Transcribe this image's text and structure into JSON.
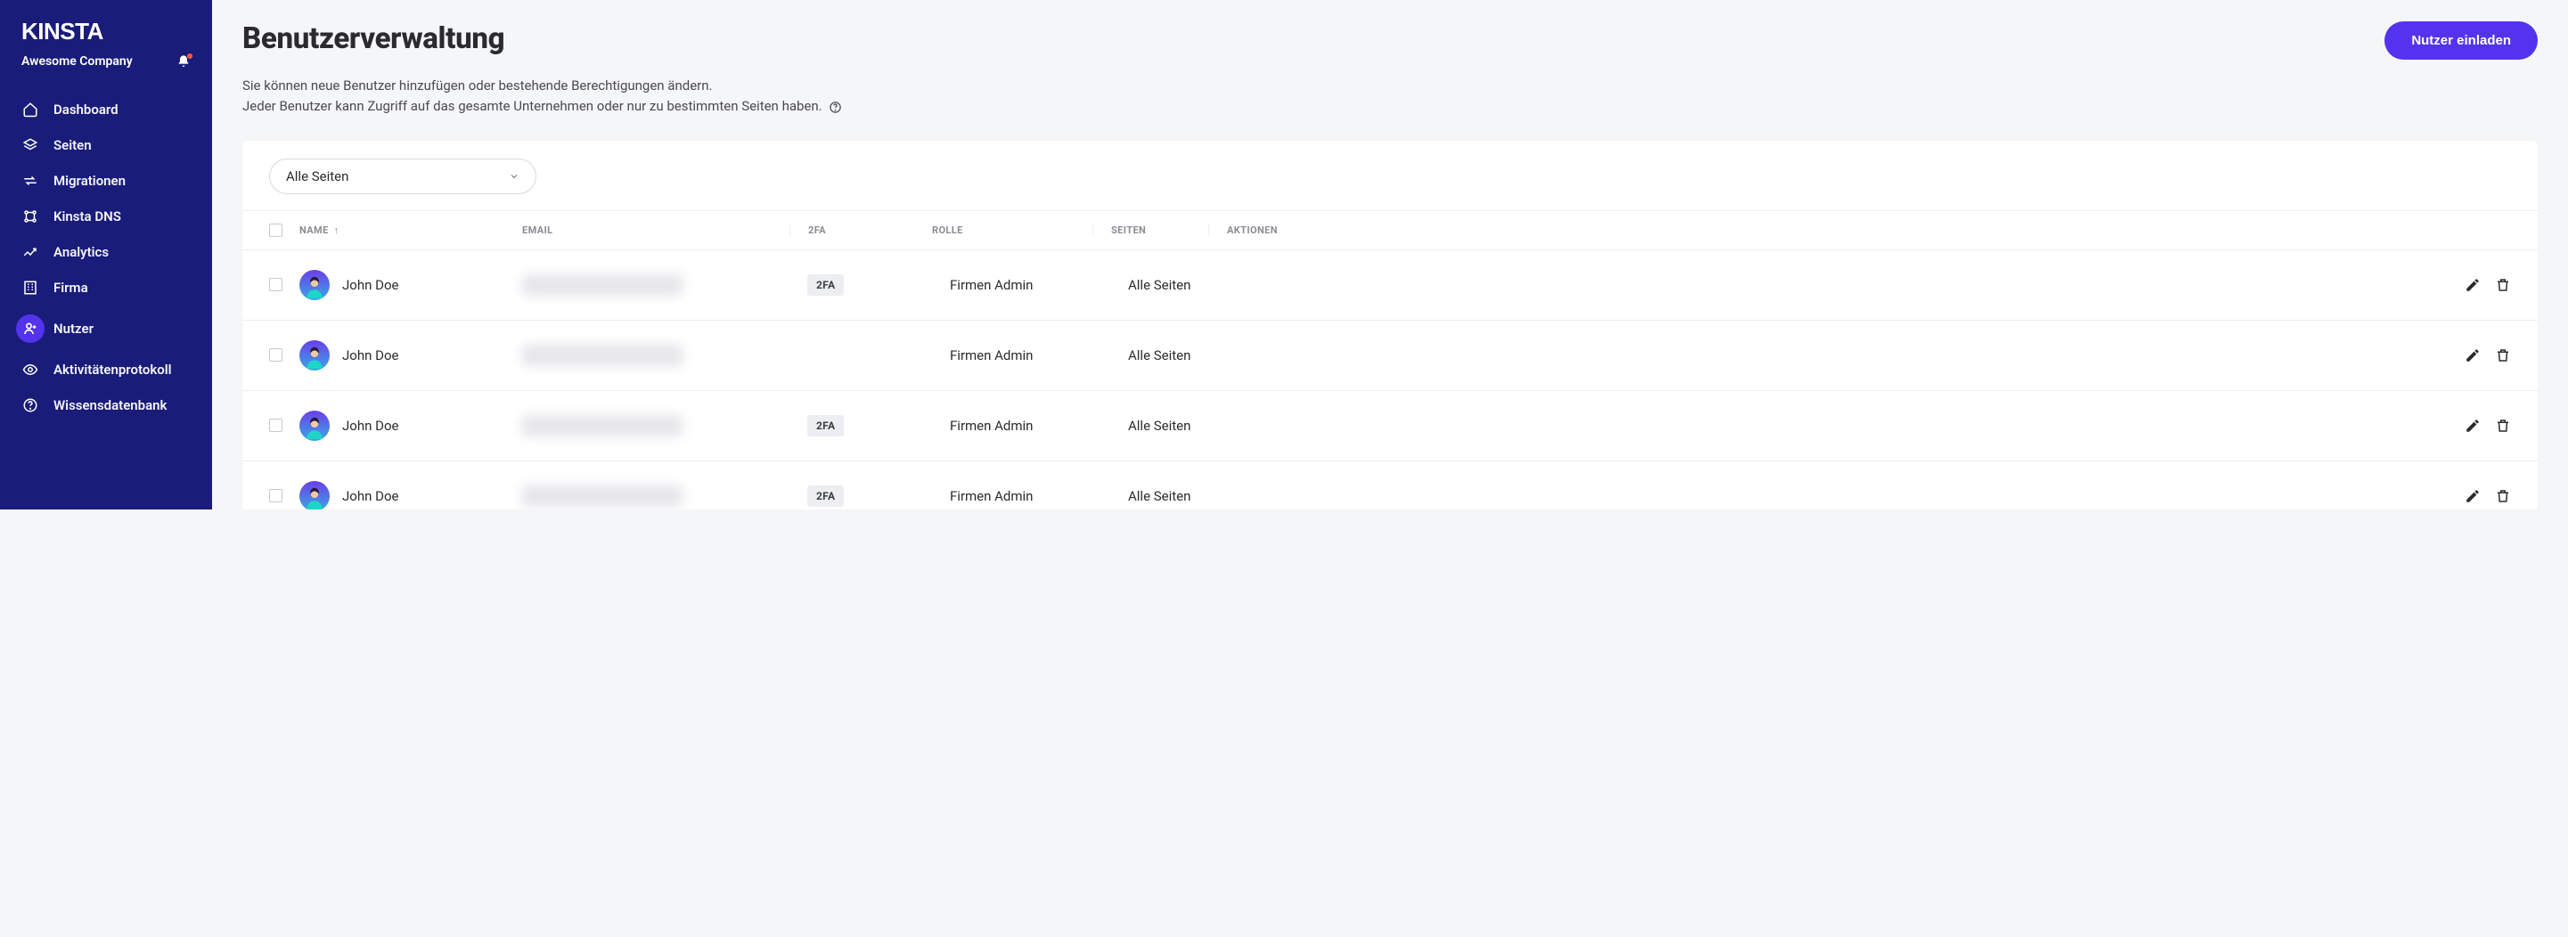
{
  "brand": "KINSTA",
  "company": "Awesome Company",
  "sidebar": {
    "items": [
      {
        "label": "Dashboard",
        "icon": "home"
      },
      {
        "label": "Seiten",
        "icon": "layers"
      },
      {
        "label": "Migrationen",
        "icon": "migrate"
      },
      {
        "label": "Kinsta DNS",
        "icon": "dns"
      },
      {
        "label": "Analytics",
        "icon": "chart"
      },
      {
        "label": "Firma",
        "icon": "building"
      },
      {
        "label": "Nutzer",
        "icon": "user-plus",
        "active": true
      },
      {
        "label": "Aktivitätenprotokoll",
        "icon": "eye"
      },
      {
        "label": "Wissensdatenbank",
        "icon": "help"
      }
    ]
  },
  "page": {
    "title": "Benutzerverwaltung",
    "invite_btn": "Nutzer einladen",
    "subtitle_line1": "Sie können neue Benutzer hinzufügen oder bestehende Berechtigungen ändern.",
    "subtitle_line2": "Jeder Benutzer kann Zugriff auf das gesamte Unternehmen oder nur zu bestimmten Seiten haben."
  },
  "filter": {
    "selected": "Alle Seiten"
  },
  "table": {
    "columns": {
      "name": "NAME",
      "email": "EMAIL",
      "twofa": "2FA",
      "role": "ROLLE",
      "sites": "SEITEN",
      "actions": "AKTIONEN"
    },
    "sort_indicator": "↑",
    "badge_2fa": "2FA",
    "rows": [
      {
        "name": "John Doe",
        "has_2fa": true,
        "role": "Firmen Admin",
        "sites": "Alle Seiten"
      },
      {
        "name": "John Doe",
        "has_2fa": false,
        "role": "Firmen Admin",
        "sites": "Alle Seiten"
      },
      {
        "name": "John Doe",
        "has_2fa": true,
        "role": "Firmen Admin",
        "sites": "Alle Seiten"
      },
      {
        "name": "John Doe",
        "has_2fa": true,
        "role": "Firmen Admin",
        "sites": "Alle Seiten"
      }
    ]
  }
}
